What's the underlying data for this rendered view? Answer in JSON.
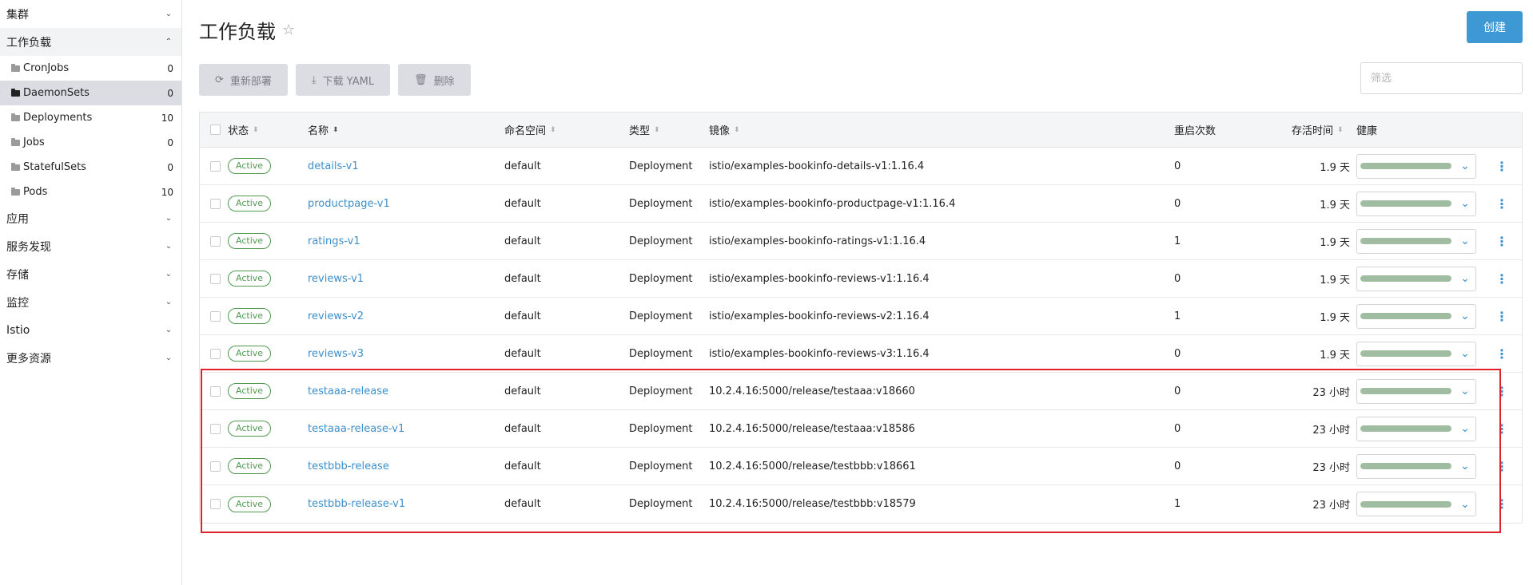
{
  "sidebar": {
    "groups_top": [
      {
        "label": "集群",
        "chevron": "⌄"
      },
      {
        "label": "工作负载",
        "chevron": "⌃"
      }
    ],
    "items": [
      {
        "label": "CronJobs",
        "count": "0"
      },
      {
        "label": "DaemonSets",
        "count": "0"
      },
      {
        "label": "Deployments",
        "count": "10"
      },
      {
        "label": "Jobs",
        "count": "0"
      },
      {
        "label": "StatefulSets",
        "count": "0"
      },
      {
        "label": "Pods",
        "count": "10"
      }
    ],
    "groups_bottom": [
      {
        "label": "应用"
      },
      {
        "label": "服务发现"
      },
      {
        "label": "存储"
      },
      {
        "label": "监控"
      },
      {
        "label": "Istio"
      },
      {
        "label": "更多资源"
      }
    ]
  },
  "header": {
    "title": "工作负载",
    "star": "☆",
    "create_label": "创建"
  },
  "toolbar": {
    "redeploy_label": "重新部署",
    "download_label": "下载 YAML",
    "delete_label": "删除",
    "filter_placeholder": "筛选"
  },
  "table": {
    "headers": {
      "status": "状态",
      "name": "名称",
      "namespace": "命名空间",
      "type": "类型",
      "image": "镜像",
      "restarts": "重启次数",
      "age": "存活时间",
      "health": "健康"
    },
    "rows": [
      {
        "status": "Active",
        "name": "details-v1",
        "namespace": "default",
        "type": "Deployment",
        "image": "istio/examples-bookinfo-details-v1:1.16.4",
        "restarts": "0",
        "age": "1.9 天",
        "health": 1.0
      },
      {
        "status": "Active",
        "name": "productpage-v1",
        "namespace": "default",
        "type": "Deployment",
        "image": "istio/examples-bookinfo-productpage-v1:1.16.4",
        "restarts": "0",
        "age": "1.9 天",
        "health": 1.0
      },
      {
        "status": "Active",
        "name": "ratings-v1",
        "namespace": "default",
        "type": "Deployment",
        "image": "istio/examples-bookinfo-ratings-v1:1.16.4",
        "restarts": "1",
        "age": "1.9 天",
        "health": 1.0
      },
      {
        "status": "Active",
        "name": "reviews-v1",
        "namespace": "default",
        "type": "Deployment",
        "image": "istio/examples-bookinfo-reviews-v1:1.16.4",
        "restarts": "0",
        "age": "1.9 天",
        "health": 1.0
      },
      {
        "status": "Active",
        "name": "reviews-v2",
        "namespace": "default",
        "type": "Deployment",
        "image": "istio/examples-bookinfo-reviews-v2:1.16.4",
        "restarts": "1",
        "age": "1.9 天",
        "health": 1.0
      },
      {
        "status": "Active",
        "name": "reviews-v3",
        "namespace": "default",
        "type": "Deployment",
        "image": "istio/examples-bookinfo-reviews-v3:1.16.4",
        "restarts": "0",
        "age": "1.9 天",
        "health": 1.0
      },
      {
        "status": "Active",
        "name": "testaaa-release",
        "namespace": "default",
        "type": "Deployment",
        "image": "10.2.4.16:5000/release/testaaa:v18660",
        "restarts": "0",
        "age": "23 小时",
        "health": 1.0
      },
      {
        "status": "Active",
        "name": "testaaa-release-v1",
        "namespace": "default",
        "type": "Deployment",
        "image": "10.2.4.16:5000/release/testaaa:v18586",
        "restarts": "0",
        "age": "23 小时",
        "health": 1.0
      },
      {
        "status": "Active",
        "name": "testbbb-release",
        "namespace": "default",
        "type": "Deployment",
        "image": "10.2.4.16:5000/release/testbbb:v18661",
        "restarts": "0",
        "age": "23 小时",
        "health": 1.0
      },
      {
        "status": "Active",
        "name": "testbbb-release-v1",
        "namespace": "default",
        "type": "Deployment",
        "image": "10.2.4.16:5000/release/testbbb:v18579",
        "restarts": "1",
        "age": "23 小时",
        "health": 1.0
      }
    ]
  },
  "colors": {
    "accent": "#3d98d3",
    "active_badge": "#4f9a4f",
    "health_fill": "#a1bda1",
    "highlight_box": "#e0202a"
  }
}
